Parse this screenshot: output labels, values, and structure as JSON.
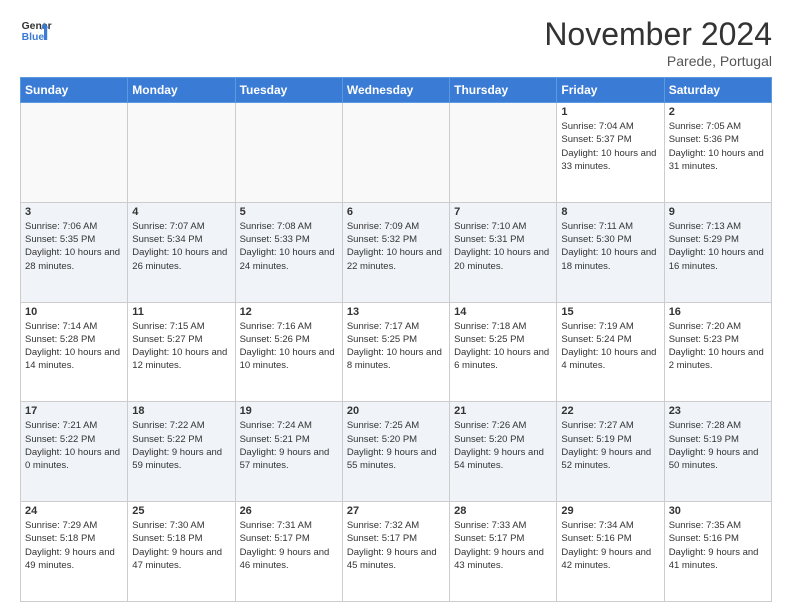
{
  "logo": {
    "line1": "General",
    "line2": "Blue"
  },
  "title": "November 2024",
  "location": "Parede, Portugal",
  "days_of_week": [
    "Sunday",
    "Monday",
    "Tuesday",
    "Wednesday",
    "Thursday",
    "Friday",
    "Saturday"
  ],
  "weeks": [
    [
      {
        "day": "",
        "info": ""
      },
      {
        "day": "",
        "info": ""
      },
      {
        "day": "",
        "info": ""
      },
      {
        "day": "",
        "info": ""
      },
      {
        "day": "",
        "info": ""
      },
      {
        "day": "1",
        "info": "Sunrise: 7:04 AM\nSunset: 5:37 PM\nDaylight: 10 hours and 33 minutes."
      },
      {
        "day": "2",
        "info": "Sunrise: 7:05 AM\nSunset: 5:36 PM\nDaylight: 10 hours and 31 minutes."
      }
    ],
    [
      {
        "day": "3",
        "info": "Sunrise: 7:06 AM\nSunset: 5:35 PM\nDaylight: 10 hours and 28 minutes."
      },
      {
        "day": "4",
        "info": "Sunrise: 7:07 AM\nSunset: 5:34 PM\nDaylight: 10 hours and 26 minutes."
      },
      {
        "day": "5",
        "info": "Sunrise: 7:08 AM\nSunset: 5:33 PM\nDaylight: 10 hours and 24 minutes."
      },
      {
        "day": "6",
        "info": "Sunrise: 7:09 AM\nSunset: 5:32 PM\nDaylight: 10 hours and 22 minutes."
      },
      {
        "day": "7",
        "info": "Sunrise: 7:10 AM\nSunset: 5:31 PM\nDaylight: 10 hours and 20 minutes."
      },
      {
        "day": "8",
        "info": "Sunrise: 7:11 AM\nSunset: 5:30 PM\nDaylight: 10 hours and 18 minutes."
      },
      {
        "day": "9",
        "info": "Sunrise: 7:13 AM\nSunset: 5:29 PM\nDaylight: 10 hours and 16 minutes."
      }
    ],
    [
      {
        "day": "10",
        "info": "Sunrise: 7:14 AM\nSunset: 5:28 PM\nDaylight: 10 hours and 14 minutes."
      },
      {
        "day": "11",
        "info": "Sunrise: 7:15 AM\nSunset: 5:27 PM\nDaylight: 10 hours and 12 minutes."
      },
      {
        "day": "12",
        "info": "Sunrise: 7:16 AM\nSunset: 5:26 PM\nDaylight: 10 hours and 10 minutes."
      },
      {
        "day": "13",
        "info": "Sunrise: 7:17 AM\nSunset: 5:25 PM\nDaylight: 10 hours and 8 minutes."
      },
      {
        "day": "14",
        "info": "Sunrise: 7:18 AM\nSunset: 5:25 PM\nDaylight: 10 hours and 6 minutes."
      },
      {
        "day": "15",
        "info": "Sunrise: 7:19 AM\nSunset: 5:24 PM\nDaylight: 10 hours and 4 minutes."
      },
      {
        "day": "16",
        "info": "Sunrise: 7:20 AM\nSunset: 5:23 PM\nDaylight: 10 hours and 2 minutes."
      }
    ],
    [
      {
        "day": "17",
        "info": "Sunrise: 7:21 AM\nSunset: 5:22 PM\nDaylight: 10 hours and 0 minutes."
      },
      {
        "day": "18",
        "info": "Sunrise: 7:22 AM\nSunset: 5:22 PM\nDaylight: 9 hours and 59 minutes."
      },
      {
        "day": "19",
        "info": "Sunrise: 7:24 AM\nSunset: 5:21 PM\nDaylight: 9 hours and 57 minutes."
      },
      {
        "day": "20",
        "info": "Sunrise: 7:25 AM\nSunset: 5:20 PM\nDaylight: 9 hours and 55 minutes."
      },
      {
        "day": "21",
        "info": "Sunrise: 7:26 AM\nSunset: 5:20 PM\nDaylight: 9 hours and 54 minutes."
      },
      {
        "day": "22",
        "info": "Sunrise: 7:27 AM\nSunset: 5:19 PM\nDaylight: 9 hours and 52 minutes."
      },
      {
        "day": "23",
        "info": "Sunrise: 7:28 AM\nSunset: 5:19 PM\nDaylight: 9 hours and 50 minutes."
      }
    ],
    [
      {
        "day": "24",
        "info": "Sunrise: 7:29 AM\nSunset: 5:18 PM\nDaylight: 9 hours and 49 minutes."
      },
      {
        "day": "25",
        "info": "Sunrise: 7:30 AM\nSunset: 5:18 PM\nDaylight: 9 hours and 47 minutes."
      },
      {
        "day": "26",
        "info": "Sunrise: 7:31 AM\nSunset: 5:17 PM\nDaylight: 9 hours and 46 minutes."
      },
      {
        "day": "27",
        "info": "Sunrise: 7:32 AM\nSunset: 5:17 PM\nDaylight: 9 hours and 45 minutes."
      },
      {
        "day": "28",
        "info": "Sunrise: 7:33 AM\nSunset: 5:17 PM\nDaylight: 9 hours and 43 minutes."
      },
      {
        "day": "29",
        "info": "Sunrise: 7:34 AM\nSunset: 5:16 PM\nDaylight: 9 hours and 42 minutes."
      },
      {
        "day": "30",
        "info": "Sunrise: 7:35 AM\nSunset: 5:16 PM\nDaylight: 9 hours and 41 minutes."
      }
    ]
  ]
}
